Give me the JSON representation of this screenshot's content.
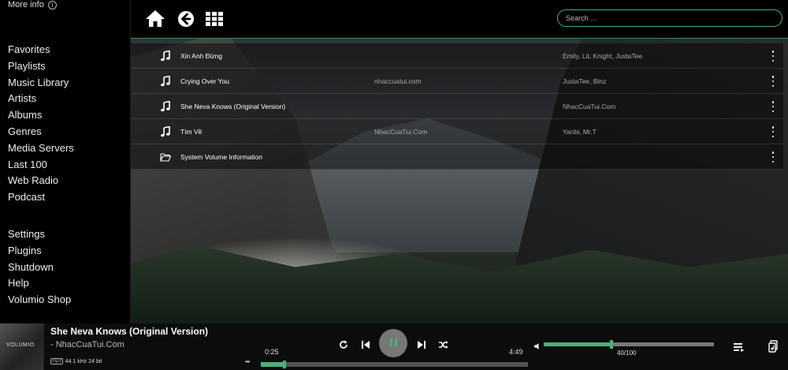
{
  "sidebar": {
    "more_info": "More info",
    "menu_primary": [
      "Favorites",
      "Playlists",
      "Music Library",
      "Artists",
      "Albums",
      "Genres",
      "Media Servers",
      "Last 100",
      "Web Radio",
      "Podcast"
    ],
    "menu_secondary": [
      "Settings",
      "Plugins",
      "Shutdown",
      "Help",
      "Volumio Shop"
    ]
  },
  "topbar": {
    "icons": [
      "home-icon",
      "back-icon",
      "grid-view-icon"
    ],
    "search_placeholder": "Search ..."
  },
  "tracks": [
    {
      "icon": "music-note-icon",
      "title": "Xin Anh Đừng",
      "album": "",
      "artist": "Emily, LiL Knight, JustaTee"
    },
    {
      "icon": "music-note-icon",
      "title": "Crying Over You",
      "album": "nhaccuatui.com",
      "artist": "JustaTee, Binz"
    },
    {
      "icon": "music-note-icon",
      "title": "She Neva Knows (Original Version)",
      "album": "",
      "artist": "NhacCuaTui.Com"
    },
    {
      "icon": "music-note-icon",
      "title": "Tìm Về",
      "album": "NhacCuaTui.Com",
      "artist": "Yanbi, Mr.T"
    },
    {
      "icon": "folder-icon",
      "title": "System Volume Information",
      "album": "",
      "artist": ""
    }
  ],
  "player": {
    "cover_text": "VOLUMIO",
    "title": "She Neva Knows (Original Version)",
    "artist": "- NhacCuaTui.Com",
    "format_badge": "mp3",
    "quality": "44.1 kHz 24 bit",
    "more": "•••",
    "time_current": "0:25",
    "time_total": "4:49",
    "seek_progress": 0.088,
    "volume_text": "40/100",
    "volume_level": 0.4,
    "state": "playing",
    "accent_color": "#4caf78"
  }
}
